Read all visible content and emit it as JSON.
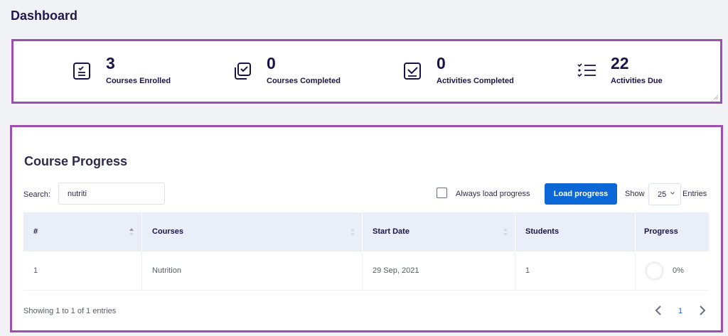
{
  "page": {
    "title": "Dashboard"
  },
  "stats": [
    {
      "value": "3",
      "label": "Courses Enrolled",
      "icon": "clipboard-list-icon"
    },
    {
      "value": "0",
      "label": "Courses Completed",
      "icon": "stacked-checkbox-icon"
    },
    {
      "value": "0",
      "label": "Activities Completed",
      "icon": "checkbox-icon"
    },
    {
      "value": "22",
      "label": "Activities Due",
      "icon": "checklist-icon"
    }
  ],
  "course_progress": {
    "title": "Course Progress",
    "search": {
      "label": "Search:",
      "value": "nutriti"
    },
    "always_load": {
      "label": "Always load progress",
      "checked": false
    },
    "load_button": "Load progress",
    "show": {
      "label": "Show",
      "value": "25",
      "suffix": "Entries"
    },
    "columns": [
      "#",
      "Courses",
      "Start Date",
      "Students",
      "Progress"
    ],
    "rows": [
      {
        "num": "1",
        "course": "Nutrition",
        "start_date": "29 Sep, 2021",
        "students": "1",
        "progress": "0%"
      }
    ],
    "footer": "Showing 1 to 1 of 1 entries",
    "pagination": {
      "current": "1"
    }
  },
  "colors": {
    "accent": "#0b66d6",
    "frame": "#9b4fb0",
    "header_bg": "#e9eef8",
    "title": "#1e1b4b"
  }
}
